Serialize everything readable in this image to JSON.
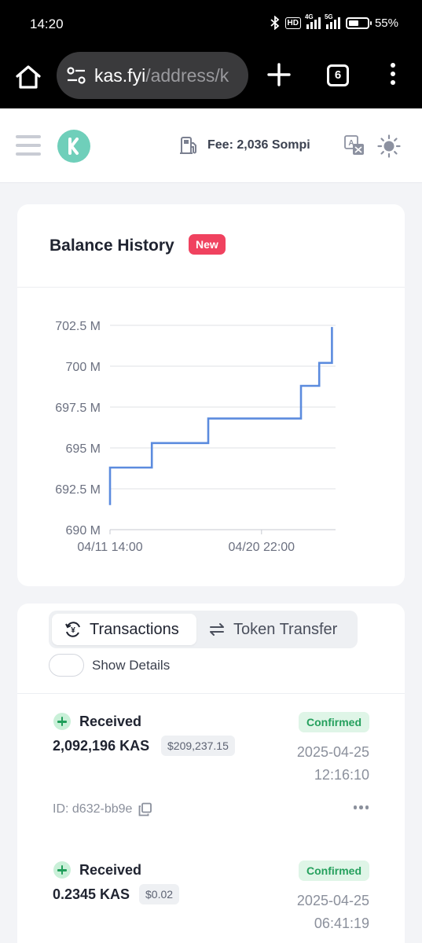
{
  "status_bar": {
    "time": "14:20",
    "network_1": "4G",
    "network_2": "5G",
    "battery": "55%"
  },
  "browser": {
    "url_host": "kas.fyi",
    "url_path": "/address/k",
    "tab_count": "6"
  },
  "header": {
    "fee_label": "Fee: 2,036 Sompi",
    "icons": [
      "menu-icon",
      "kaspa-logo",
      "gas-pump-icon",
      "translate-icon",
      "sun-icon"
    ],
    "accent_color": "#6fcfba"
  },
  "balance_card": {
    "title": "Balance History",
    "badge": "New"
  },
  "chart_data": {
    "type": "line",
    "step": true,
    "y_ticks": [
      "702.5 M",
      "700 M",
      "697.5 M",
      "695 M",
      "692.5 M",
      "690 M"
    ],
    "x_ticks": [
      "04/11 14:00",
      "04/20 22:00"
    ],
    "ylim": [
      690,
      702.5
    ],
    "y_unit": "M",
    "grid": true,
    "line_color": "#5b8bde",
    "points": [
      {
        "t": 0.0,
        "v": 691.5
      },
      {
        "t": 0.0,
        "v": 693.8
      },
      {
        "t": 2.3,
        "v": 693.8
      },
      {
        "t": 2.3,
        "v": 695.3
      },
      {
        "t": 5.4,
        "v": 695.3
      },
      {
        "t": 5.4,
        "v": 696.8
      },
      {
        "t": 10.5,
        "v": 696.8
      },
      {
        "t": 10.5,
        "v": 698.8
      },
      {
        "t": 11.5,
        "v": 698.8
      },
      {
        "t": 11.5,
        "v": 700.2
      },
      {
        "t": 12.2,
        "v": 700.2
      },
      {
        "t": 12.2,
        "v": 702.4
      }
    ],
    "x_range_days": [
      0,
      12.4
    ],
    "x_tick_days": [
      0,
      8.33
    ]
  },
  "tabs": {
    "transactions": "Transactions",
    "token_transfer": "Token Transfer",
    "active": "transactions"
  },
  "show_details": {
    "label": "Show Details",
    "enabled": false
  },
  "transactions": [
    {
      "direction": "Received",
      "status": "Confirmed",
      "amount": "2,092,196 KAS",
      "usd": "$209,237.15",
      "date": "2025-04-25",
      "time": "12:16:10",
      "id": "ID: d632-bb9e"
    },
    {
      "direction": "Received",
      "status": "Confirmed",
      "amount": "0.2345 KAS",
      "usd": "$0.02",
      "date": "2025-04-25",
      "time": "06:41:19",
      "id": ""
    }
  ]
}
